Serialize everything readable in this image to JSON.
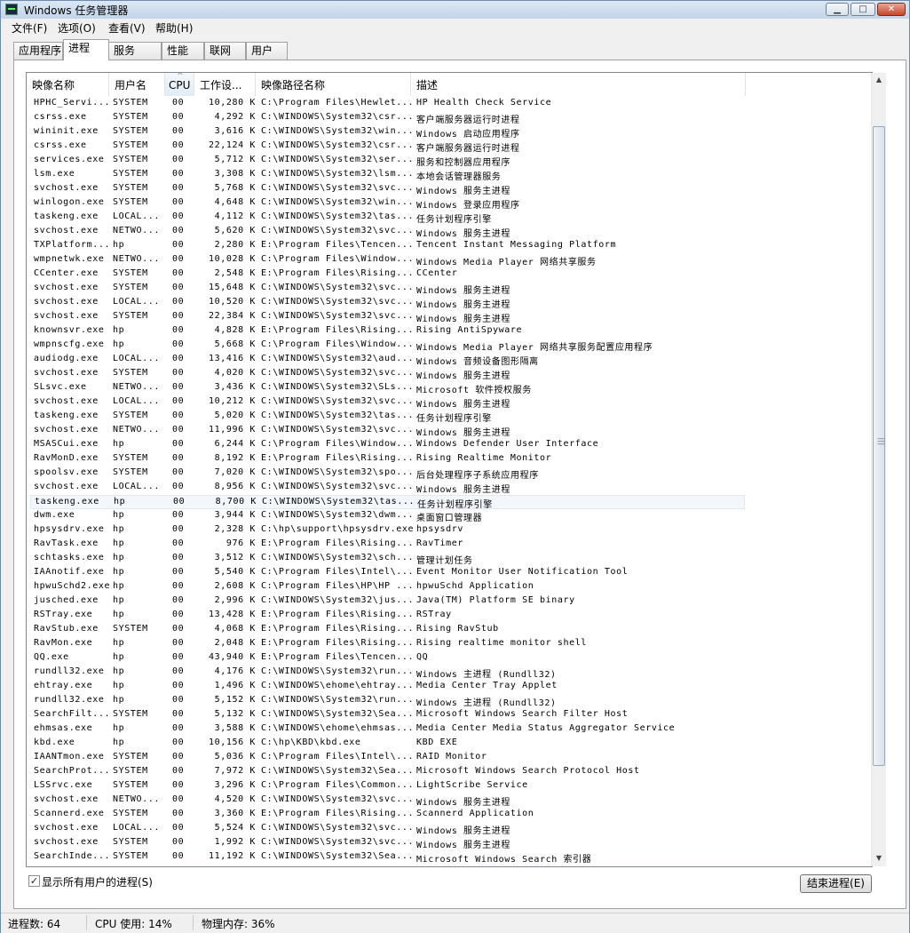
{
  "window": {
    "title": "Windows 任务管理器",
    "minimize_icon": "minimize-icon",
    "maximize_icon": "maximize-icon",
    "close_icon": "close-icon"
  },
  "menu": [
    {
      "label": "文件(F)"
    },
    {
      "label": "选项(O)"
    },
    {
      "label": "查看(V)"
    },
    {
      "label": "帮助(H)"
    }
  ],
  "tabs": [
    {
      "label": "应用程序"
    },
    {
      "label": "进程",
      "active": true
    },
    {
      "label": "服务"
    },
    {
      "label": "性能"
    },
    {
      "label": "联网"
    },
    {
      "label": "用户"
    }
  ],
  "columns": {
    "image_name": "映像名称",
    "user": "用户名",
    "cpu": "CPU",
    "memory": "工作设...",
    "path": "映像路径名称",
    "desc": "描述"
  },
  "processes": [
    {
      "name": "HPHC_Servi...",
      "user": "SYSTEM",
      "cpu": "00",
      "mem": "10,280 K",
      "path": "C:\\Program Files\\Hewlet...",
      "desc": "HP Health Check Service"
    },
    {
      "name": "csrss.exe",
      "user": "SYSTEM",
      "cpu": "00",
      "mem": "4,292 K",
      "path": "C:\\WINDOWS\\System32\\csr...",
      "desc": "客户端服务器运行时进程"
    },
    {
      "name": "wininit.exe",
      "user": "SYSTEM",
      "cpu": "00",
      "mem": "3,616 K",
      "path": "C:\\WINDOWS\\System32\\win...",
      "desc": "Windows 启动应用程序"
    },
    {
      "name": "csrss.exe",
      "user": "SYSTEM",
      "cpu": "00",
      "mem": "22,124 K",
      "path": "C:\\WINDOWS\\System32\\csr...",
      "desc": "客户端服务器运行时进程"
    },
    {
      "name": "services.exe",
      "user": "SYSTEM",
      "cpu": "00",
      "mem": "5,712 K",
      "path": "C:\\WINDOWS\\System32\\ser...",
      "desc": "服务和控制器应用程序"
    },
    {
      "name": "lsm.exe",
      "user": "SYSTEM",
      "cpu": "00",
      "mem": "3,308 K",
      "path": "C:\\WINDOWS\\System32\\lsm...",
      "desc": "本地会话管理器服务"
    },
    {
      "name": "svchost.exe",
      "user": "SYSTEM",
      "cpu": "00",
      "mem": "5,768 K",
      "path": "C:\\WINDOWS\\System32\\svc...",
      "desc": "Windows 服务主进程"
    },
    {
      "name": "winlogon.exe",
      "user": "SYSTEM",
      "cpu": "00",
      "mem": "4,648 K",
      "path": "C:\\WINDOWS\\System32\\win...",
      "desc": "Windows 登录应用程序"
    },
    {
      "name": "taskeng.exe",
      "user": "LOCAL...",
      "cpu": "00",
      "mem": "4,112 K",
      "path": "C:\\WINDOWS\\System32\\tas...",
      "desc": "任务计划程序引擎"
    },
    {
      "name": "svchost.exe",
      "user": "NETWO...",
      "cpu": "00",
      "mem": "5,620 K",
      "path": "C:\\WINDOWS\\System32\\svc...",
      "desc": "Windows 服务主进程"
    },
    {
      "name": "TXPlatform...",
      "user": "hp",
      "cpu": "00",
      "mem": "2,280 K",
      "path": "E:\\Program Files\\Tencen...",
      "desc": "Tencent Instant Messaging Platform"
    },
    {
      "name": "wmpnetwk.exe",
      "user": "NETWO...",
      "cpu": "00",
      "mem": "10,028 K",
      "path": "C:\\Program Files\\Window...",
      "desc": "Windows Media Player 网络共享服务"
    },
    {
      "name": "CCenter.exe",
      "user": "SYSTEM",
      "cpu": "00",
      "mem": "2,548 K",
      "path": "E:\\Program Files\\Rising...",
      "desc": "CCenter"
    },
    {
      "name": "svchost.exe",
      "user": "SYSTEM",
      "cpu": "00",
      "mem": "15,648 K",
      "path": "C:\\WINDOWS\\System32\\svc...",
      "desc": "Windows 服务主进程"
    },
    {
      "name": "svchost.exe",
      "user": "LOCAL...",
      "cpu": "00",
      "mem": "10,520 K",
      "path": "C:\\WINDOWS\\System32\\svc...",
      "desc": "Windows 服务主进程"
    },
    {
      "name": "svchost.exe",
      "user": "SYSTEM",
      "cpu": "00",
      "mem": "22,384 K",
      "path": "C:\\WINDOWS\\System32\\svc...",
      "desc": "Windows 服务主进程"
    },
    {
      "name": "knownsvr.exe",
      "user": "hp",
      "cpu": "00",
      "mem": "4,828 K",
      "path": "E:\\Program Files\\Rising...",
      "desc": "Rising AntiSpyware"
    },
    {
      "name": "wmpnscfg.exe",
      "user": "hp",
      "cpu": "00",
      "mem": "5,668 K",
      "path": "C:\\Program Files\\Window...",
      "desc": "Windows Media Player 网络共享服务配置应用程序"
    },
    {
      "name": "audiodg.exe",
      "user": "LOCAL...",
      "cpu": "00",
      "mem": "13,416 K",
      "path": "C:\\WINDOWS\\System32\\aud...",
      "desc": "Windows 音频设备图形隔离"
    },
    {
      "name": "svchost.exe",
      "user": "SYSTEM",
      "cpu": "00",
      "mem": "4,020 K",
      "path": "C:\\WINDOWS\\System32\\svc...",
      "desc": "Windows 服务主进程"
    },
    {
      "name": "SLsvc.exe",
      "user": "NETWO...",
      "cpu": "00",
      "mem": "3,436 K",
      "path": "C:\\WINDOWS\\System32\\SLs...",
      "desc": "Microsoft 软件授权服务"
    },
    {
      "name": "svchost.exe",
      "user": "LOCAL...",
      "cpu": "00",
      "mem": "10,212 K",
      "path": "C:\\WINDOWS\\System32\\svc...",
      "desc": "Windows 服务主进程"
    },
    {
      "name": "taskeng.exe",
      "user": "SYSTEM",
      "cpu": "00",
      "mem": "5,020 K",
      "path": "C:\\WINDOWS\\System32\\tas...",
      "desc": "任务计划程序引擎"
    },
    {
      "name": "svchost.exe",
      "user": "NETWO...",
      "cpu": "00",
      "mem": "11,996 K",
      "path": "C:\\WINDOWS\\System32\\svc...",
      "desc": "Windows 服务主进程"
    },
    {
      "name": "MSASCui.exe",
      "user": "hp",
      "cpu": "00",
      "mem": "6,244 K",
      "path": "C:\\Program Files\\Window...",
      "desc": "Windows Defender User Interface"
    },
    {
      "name": "RavMonD.exe",
      "user": "SYSTEM",
      "cpu": "00",
      "mem": "8,192 K",
      "path": "E:\\Program Files\\Rising...",
      "desc": "Rising Realtime Monitor"
    },
    {
      "name": "spoolsv.exe",
      "user": "SYSTEM",
      "cpu": "00",
      "mem": "7,020 K",
      "path": "C:\\WINDOWS\\System32\\spo...",
      "desc": "后台处理程序子系统应用程序"
    },
    {
      "name": "svchost.exe",
      "user": "LOCAL...",
      "cpu": "00",
      "mem": "8,956 K",
      "path": "C:\\WINDOWS\\System32\\svc...",
      "desc": "Windows 服务主进程"
    },
    {
      "name": "taskeng.exe",
      "user": "hp",
      "cpu": "00",
      "mem": "8,700 K",
      "path": "C:\\WINDOWS\\System32\\tas...",
      "desc": "任务计划程序引擎",
      "selected": true
    },
    {
      "name": "dwm.exe",
      "user": "hp",
      "cpu": "00",
      "mem": "3,944 K",
      "path": "C:\\WINDOWS\\System32\\dwm...",
      "desc": "桌面窗口管理器"
    },
    {
      "name": "hpsysdrv.exe",
      "user": "hp",
      "cpu": "00",
      "mem": "2,328 K",
      "path": "C:\\hp\\support\\hpsysdrv.exe",
      "desc": "hpsysdrv"
    },
    {
      "name": "RavTask.exe",
      "user": "hp",
      "cpu": "00",
      "mem": "976 K",
      "path": "E:\\Program Files\\Rising...",
      "desc": "RavTimer"
    },
    {
      "name": "schtasks.exe",
      "user": "hp",
      "cpu": "00",
      "mem": "3,512 K",
      "path": "C:\\WINDOWS\\System32\\sch...",
      "desc": "管理计划任务"
    },
    {
      "name": "IAAnotif.exe",
      "user": "hp",
      "cpu": "00",
      "mem": "5,540 K",
      "path": "C:\\Program Files\\Intel\\...",
      "desc": "Event Monitor User Notification Tool"
    },
    {
      "name": "hpwuSchd2.exe",
      "user": "hp",
      "cpu": "00",
      "mem": "2,608 K",
      "path": "C:\\Program Files\\HP\\HP ...",
      "desc": "hpwuSchd Application"
    },
    {
      "name": "jusched.exe",
      "user": "hp",
      "cpu": "00",
      "mem": "2,996 K",
      "path": "C:\\WINDOWS\\System32\\jus...",
      "desc": "Java(TM) Platform SE binary"
    },
    {
      "name": "RSTray.exe",
      "user": "hp",
      "cpu": "00",
      "mem": "13,428 K",
      "path": "E:\\Program Files\\Rising...",
      "desc": "RSTray"
    },
    {
      "name": "RavStub.exe",
      "user": "SYSTEM",
      "cpu": "00",
      "mem": "4,068 K",
      "path": "E:\\Program Files\\Rising...",
      "desc": "Rising RavStub"
    },
    {
      "name": "RavMon.exe",
      "user": "hp",
      "cpu": "00",
      "mem": "2,048 K",
      "path": "E:\\Program Files\\Rising...",
      "desc": "Rising realtime monitor shell"
    },
    {
      "name": "QQ.exe",
      "user": "hp",
      "cpu": "00",
      "mem": "43,940 K",
      "path": "E:\\Program Files\\Tencen...",
      "desc": "QQ"
    },
    {
      "name": "rundll32.exe",
      "user": "hp",
      "cpu": "00",
      "mem": "4,176 K",
      "path": "C:\\WINDOWS\\System32\\run...",
      "desc": "Windows 主进程 (Rundll32)"
    },
    {
      "name": "ehtray.exe",
      "user": "hp",
      "cpu": "00",
      "mem": "1,496 K",
      "path": "C:\\WINDOWS\\ehome\\ehtray...",
      "desc": "Media Center Tray Applet"
    },
    {
      "name": "rundll32.exe",
      "user": "hp",
      "cpu": "00",
      "mem": "5,152 K",
      "path": "C:\\WINDOWS\\System32\\run...",
      "desc": "Windows 主进程 (Rundll32)"
    },
    {
      "name": "SearchFilt...",
      "user": "SYSTEM",
      "cpu": "00",
      "mem": "5,132 K",
      "path": "C:\\WINDOWS\\System32\\Sea...",
      "desc": "Microsoft Windows Search Filter Host"
    },
    {
      "name": "ehmsas.exe",
      "user": "hp",
      "cpu": "00",
      "mem": "3,588 K",
      "path": "C:\\WINDOWS\\ehome\\ehmsas...",
      "desc": "Media Center Media Status Aggregator Service"
    },
    {
      "name": "kbd.exe",
      "user": "hp",
      "cpu": "00",
      "mem": "10,156 K",
      "path": "C:\\hp\\KBD\\kbd.exe",
      "desc": "KBD EXE"
    },
    {
      "name": "IAANTmon.exe",
      "user": "SYSTEM",
      "cpu": "00",
      "mem": "5,036 K",
      "path": "C:\\Program Files\\Intel\\...",
      "desc": "RAID Monitor"
    },
    {
      "name": "SearchProt...",
      "user": "SYSTEM",
      "cpu": "00",
      "mem": "7,972 K",
      "path": "C:\\WINDOWS\\System32\\Sea...",
      "desc": "Microsoft Windows Search Protocol Host"
    },
    {
      "name": "LSSrvc.exe",
      "user": "SYSTEM",
      "cpu": "00",
      "mem": "3,296 K",
      "path": "C:\\Program Files\\Common...",
      "desc": "LightScribe Service"
    },
    {
      "name": "svchost.exe",
      "user": "NETWO...",
      "cpu": "00",
      "mem": "4,520 K",
      "path": "C:\\WINDOWS\\System32\\svc...",
      "desc": "Windows 服务主进程"
    },
    {
      "name": "Scannerd.exe",
      "user": "SYSTEM",
      "cpu": "00",
      "mem": "3,360 K",
      "path": "E:\\Program Files\\Rising...",
      "desc": "Scannerd Application"
    },
    {
      "name": "svchost.exe",
      "user": "LOCAL...",
      "cpu": "00",
      "mem": "5,524 K",
      "path": "C:\\WINDOWS\\System32\\svc...",
      "desc": "Windows 服务主进程"
    },
    {
      "name": "svchost.exe",
      "user": "SYSTEM",
      "cpu": "00",
      "mem": "1,992 K",
      "path": "C:\\WINDOWS\\System32\\svc...",
      "desc": "Windows 服务主进程"
    },
    {
      "name": "SearchInde...",
      "user": "SYSTEM",
      "cpu": "00",
      "mem": "11,192 K",
      "path": "C:\\WINDOWS\\System32\\Sea...",
      "desc": "Microsoft Windows Search 索引器"
    }
  ],
  "show_all_users": {
    "label": "显示所有用户的进程(S)",
    "checked": true,
    "check_mark": "✓"
  },
  "end_process_button": "结束进程(E)",
  "status": {
    "processes": "进程数: 64",
    "cpu": "CPU 使用: 14%",
    "memory": "物理内存: 36%"
  }
}
